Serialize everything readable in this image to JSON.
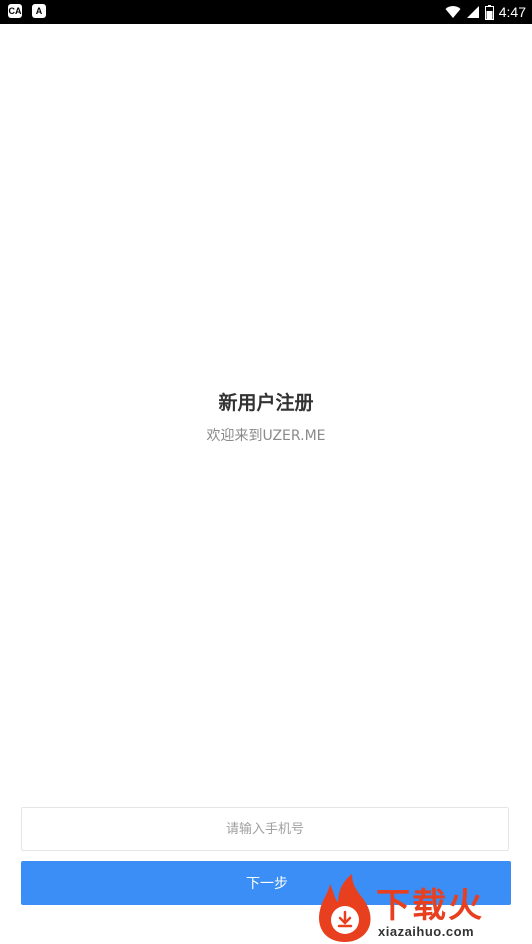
{
  "status_bar": {
    "time": "4:47",
    "left_icons": [
      "ca-app-icon",
      "a-app-icon"
    ],
    "left_icon_text": [
      "CA",
      "A"
    ]
  },
  "header": {
    "title": "新用户注册",
    "subtitle": "欢迎来到UZER.ME"
  },
  "form": {
    "phone_placeholder": "请输入手机号",
    "phone_value": "",
    "next_label": "下一步"
  },
  "watermark": {
    "brand": "下载火",
    "domain": "xiazaihuo.com"
  },
  "colors": {
    "primary": "#3a8ef6",
    "watermark": "#e8401f"
  }
}
